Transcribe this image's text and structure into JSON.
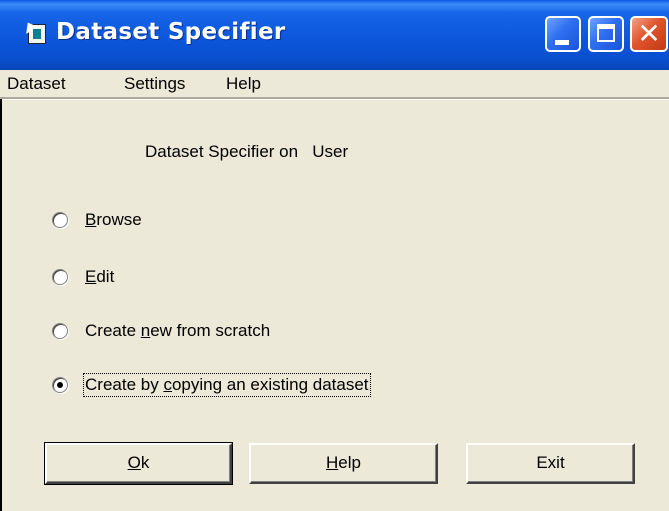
{
  "window": {
    "title": "Dataset Specifier",
    "controls": {
      "minimize": "minimize",
      "maximize": "maximize",
      "close": "✕"
    }
  },
  "menu": {
    "items": [
      {
        "label": "Dataset"
      },
      {
        "label": "Settings"
      },
      {
        "label": "Help"
      }
    ]
  },
  "main": {
    "heading": "Dataset Specifier on   User",
    "options": [
      {
        "pre": "",
        "key": "B",
        "post": "rowse",
        "checked": false
      },
      {
        "pre": "",
        "key": "E",
        "post": "dit",
        "checked": false
      },
      {
        "pre": "Create ",
        "key": "n",
        "post": "ew from scratch",
        "checked": false
      },
      {
        "pre": "Create by ",
        "key": "c",
        "post": "opying an existing dataset",
        "checked": true
      }
    ]
  },
  "buttons": {
    "ok": {
      "key": "O",
      "post": "k"
    },
    "help": {
      "key": "H",
      "post": "elp"
    },
    "exit": {
      "label": "Exit"
    }
  },
  "colors": {
    "titlebar": "#0b55d9",
    "close_button": "#e0542c",
    "face": "#ece9d8"
  }
}
